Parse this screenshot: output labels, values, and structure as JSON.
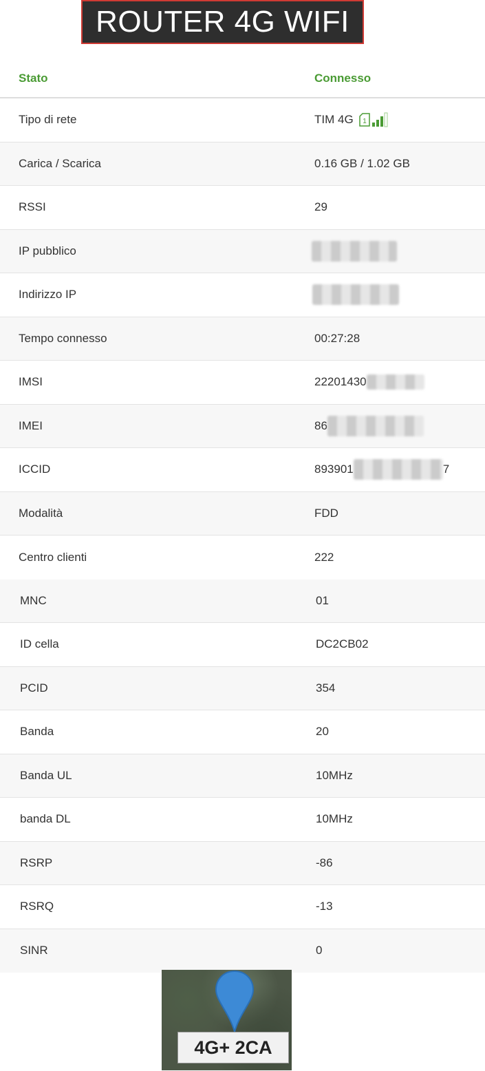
{
  "banner": {
    "title": "ROUTER 4G WIFI"
  },
  "header": {
    "col1": "Stato",
    "col2": "Connesso"
  },
  "rows": [
    {
      "label": "Tipo di rete",
      "value": "TIM 4G"
    },
    {
      "label": "Carica / Scarica",
      "value": "0.16 GB / 1.02 GB"
    },
    {
      "label": "RSSI",
      "value": "29"
    },
    {
      "label": "IP pubblico",
      "value": ""
    },
    {
      "label": "Indirizzo IP",
      "value": ""
    },
    {
      "label": "Tempo connesso",
      "value": "00:27:28"
    },
    {
      "label": "IMSI",
      "value": "22201430"
    },
    {
      "label": "IMEI",
      "value": "86"
    },
    {
      "label": "ICCID",
      "value": "893901",
      "value_suffix": "7"
    },
    {
      "label": "Modalità",
      "value": "FDD"
    },
    {
      "label": "Centro clienti",
      "value": "222"
    },
    {
      "label": "MNC",
      "value": "01"
    },
    {
      "label": "ID cella",
      "value": "DC2CB02"
    },
    {
      "label": "PCID",
      "value": "354"
    },
    {
      "label": "Banda",
      "value": "20"
    },
    {
      "label": "Banda UL",
      "value": "10MHz"
    },
    {
      "label": "banda DL",
      "value": "10MHz"
    },
    {
      "label": "RSRP",
      "value": "-86"
    },
    {
      "label": "RSRQ",
      "value": "-13"
    },
    {
      "label": "SINR",
      "value": "0"
    }
  ],
  "badge": {
    "label": "4G+ 2CA"
  },
  "icons": {
    "sim": "sim-card-icon",
    "signal": "signal-bars-icon",
    "pin": "map-pin-icon"
  },
  "colors": {
    "accent": "#4a9b34",
    "banner_bg": "#2e2e2e",
    "banner_border": "#d03a34",
    "pin": "#3d8ad6"
  },
  "signal_level": 0.75
}
